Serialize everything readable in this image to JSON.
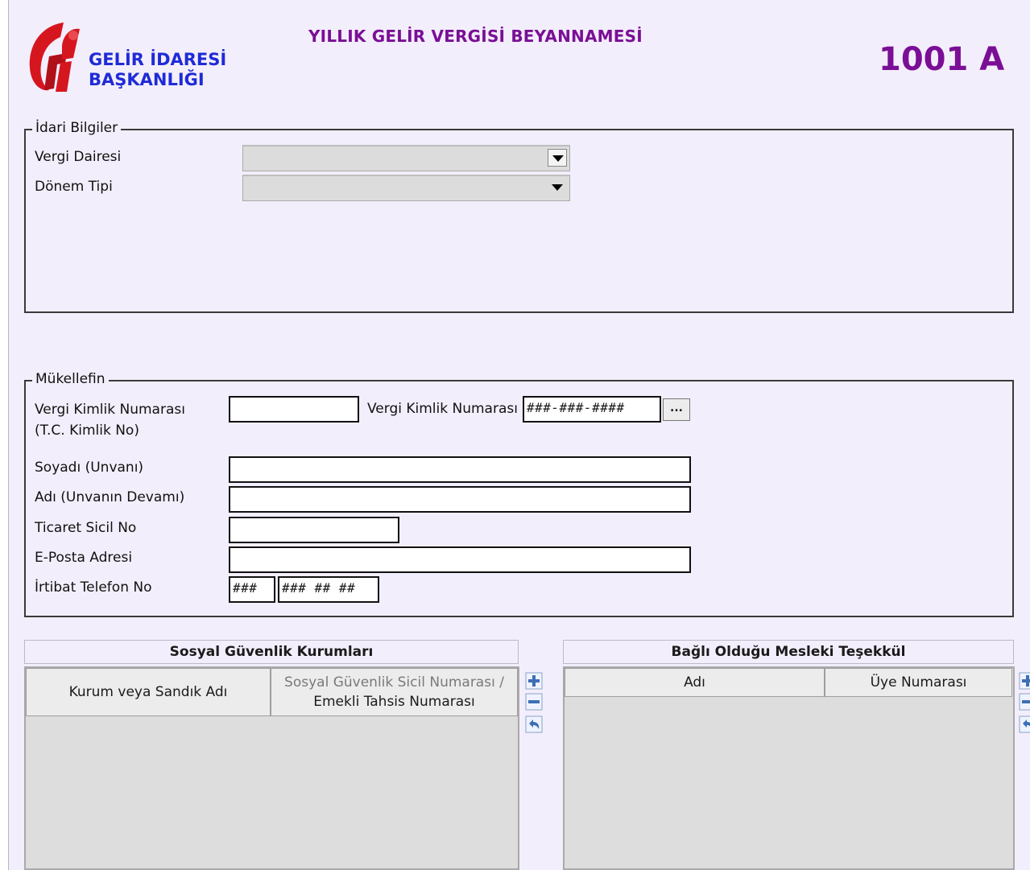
{
  "header": {
    "org_line1": "GELİR İDARESİ",
    "org_line2": "BAŞKANLIĞI",
    "title": "YILLIK GELİR VERGİSİ BEYANNAMESİ",
    "form_no": "1001 A",
    "logo_icon": "gib-logo-icon"
  },
  "idari": {
    "legend": "İdari Bilgiler",
    "vergi_dairesi_label": "Vergi Dairesi",
    "vergi_dairesi_value": "",
    "donem_tipi_label": "Dönem Tipi",
    "donem_tipi_value": ""
  },
  "mukellef": {
    "legend": "Mükellefin",
    "vkn_label_line1": "Vergi Kimlik Numarası",
    "vkn_label_line2": "(T.C. Kimlik No)",
    "vkn_value": "",
    "vkn2_label": "Vergi Kimlik Numarası",
    "vkn2_mask": "###-###-####",
    "lookup_label": "...",
    "soyadi_label": "Soyadı (Unvanı)",
    "adi_label": "Adı (Unvanın Devamı)",
    "ticaret_label": "Ticaret Sicil No",
    "eposta_label": "E-Posta Adresi",
    "telefon_label": "İrtibat Telefon No",
    "telefon_area_mask": "###",
    "telefon_number_mask": "### ## ##"
  },
  "sgk": {
    "title": "Sosyal Güvenlik Kurumları",
    "col1": "Kurum veya Sandık Adı",
    "col2_line1": "Sosyal Güvenlik Sicil Numarası /",
    "col2_line2": "Emekli Tahsis Numarası",
    "buttons": [
      "add-row-icon",
      "remove-row-icon",
      "undo-row-icon"
    ]
  },
  "meslek": {
    "title": "Bağlı Olduğu Mesleki Teşekkül",
    "col1": "Adı",
    "col2": "Üye Numarası"
  },
  "colors": {
    "background": "#f3eefb",
    "title_purple": "#7a0f96",
    "org_blue": "#1f2bd6",
    "logo_red": "#d6161f"
  }
}
